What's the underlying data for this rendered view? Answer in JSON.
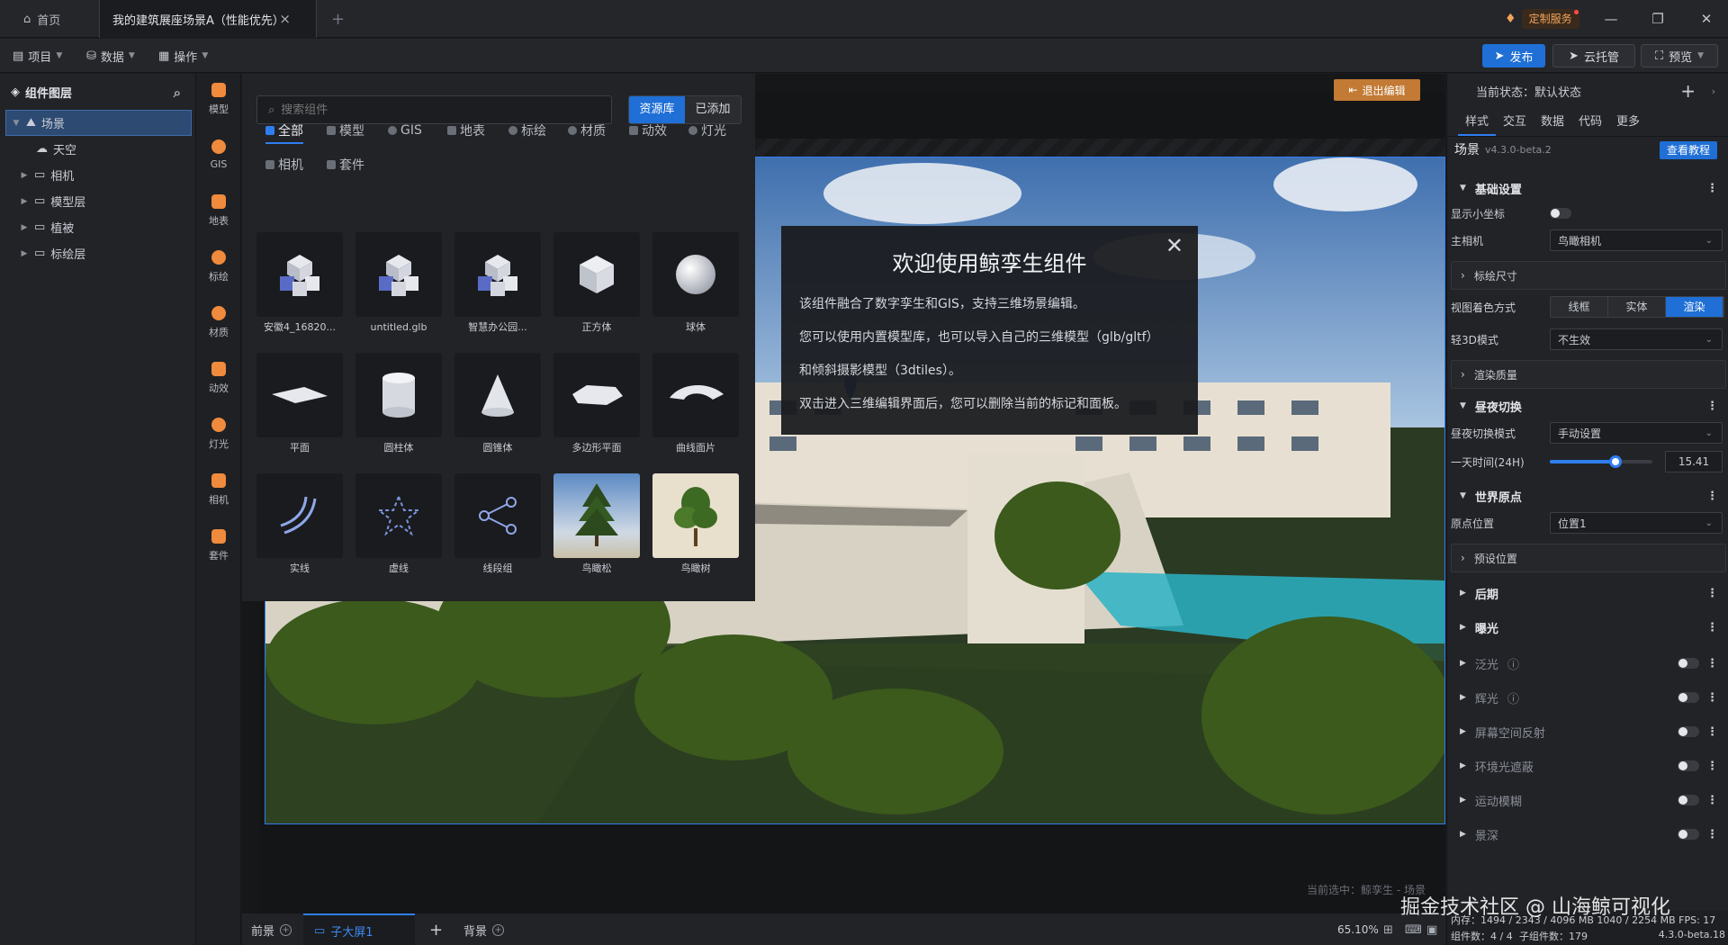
{
  "titlebar": {
    "home_tab": "首页",
    "scene_tab": "我的建筑展座场景A（性能优先）",
    "custom_service": "定制服务"
  },
  "menubar": {
    "project": "项目",
    "data": "数据",
    "operate": "操作",
    "publish": "发布",
    "cloud": "云托管",
    "preview": "预览"
  },
  "layers": {
    "title": "组件图层",
    "items": [
      {
        "label": "场景",
        "selected": true
      },
      {
        "label": "天空"
      },
      {
        "label": "相机"
      },
      {
        "label": "模型层"
      },
      {
        "label": "植被"
      },
      {
        "label": "标绘层"
      }
    ]
  },
  "categories": [
    "模型",
    "GIS",
    "地表",
    "标绘",
    "材质",
    "动效",
    "灯光",
    "相机",
    "套件"
  ],
  "library": {
    "search_placeholder": "搜索组件",
    "switch": [
      "资源库",
      "已添加"
    ],
    "filters": [
      "全部",
      "模型",
      "GIS",
      "地表",
      "标绘",
      "材质",
      "动效",
      "灯光",
      "相机",
      "套件"
    ],
    "cards": [
      "安徽4_16820...",
      "untitled.glb",
      "智慧办公园...",
      "正方体",
      "球体",
      "平面",
      "圆柱体",
      "圆锥体",
      "多边形平面",
      "曲线面片",
      "实线",
      "虚线",
      "线段组",
      "鸟瞰松",
      "鸟瞰树"
    ]
  },
  "viewport": {
    "exit_edit": "退出编辑",
    "current_selection": "当前选中：鲸孪生 - 场景"
  },
  "welcome": {
    "title": "欢迎使用鲸孪生组件",
    "lines": [
      "该组件融合了数字孪生和GIS，支持三维场景编辑。",
      "您可以使用内置模型库，也可以导入自己的三维模型（glb/gltf）",
      "和倾斜摄影模型（3dtiles）。",
      "双击进入三维编辑界面后，您可以删除当前的标记和面板。"
    ]
  },
  "bottombar": {
    "foreground": "前景",
    "sub_screen": "子大屏1",
    "background": "背景",
    "zoom": "65.10%"
  },
  "props": {
    "state_label": "当前状态：默认状态",
    "tabs": [
      "样式",
      "交互",
      "数据",
      "代码",
      "更多"
    ],
    "scene_title": "场景",
    "scene_version": "v4.3.0-beta.2",
    "tutorial": "查看教程",
    "basic": "基础设置",
    "show_axes": "显示小坐标",
    "main_camera": "主相机",
    "main_camera_value": "鸟瞰相机",
    "label_size": "标绘尺寸",
    "view_color_mode": "视图着色方式",
    "color_modes": [
      "线框",
      "实体",
      "渲染"
    ],
    "light3d": "轻3D模式",
    "light3d_value": "不生效",
    "render_quality": "渲染质量",
    "day_night": "昼夜切换",
    "switch_mode": "昼夜切换模式",
    "switch_mode_value": "手动设置",
    "day_time": "一天时间(24H)",
    "day_time_value": "15.41",
    "day_time_fraction": 0.64,
    "world_origin": "世界原点",
    "origin_pos": "原点位置",
    "origin_pos_value": "位置1",
    "preset_pos": "预设位置",
    "post": "后期",
    "exposure": "曝光",
    "floodlight": "泛光",
    "glare": "辉光",
    "ssr": "屏幕空间反射",
    "ao": "环境光遮蔽",
    "motion_blur": "运动模糊",
    "extra": "景深"
  },
  "footer": {
    "line1": "内存：1494 / 2343 / 4096 MB  1040 / 2254 MB  FPS: 17",
    "count_components": "组件数：4 / 4",
    "count_sub": "子组件数：179",
    "version": "4.3.0-beta.18"
  },
  "watermark": "掘金技术社区 @ 山海鲸可视化"
}
